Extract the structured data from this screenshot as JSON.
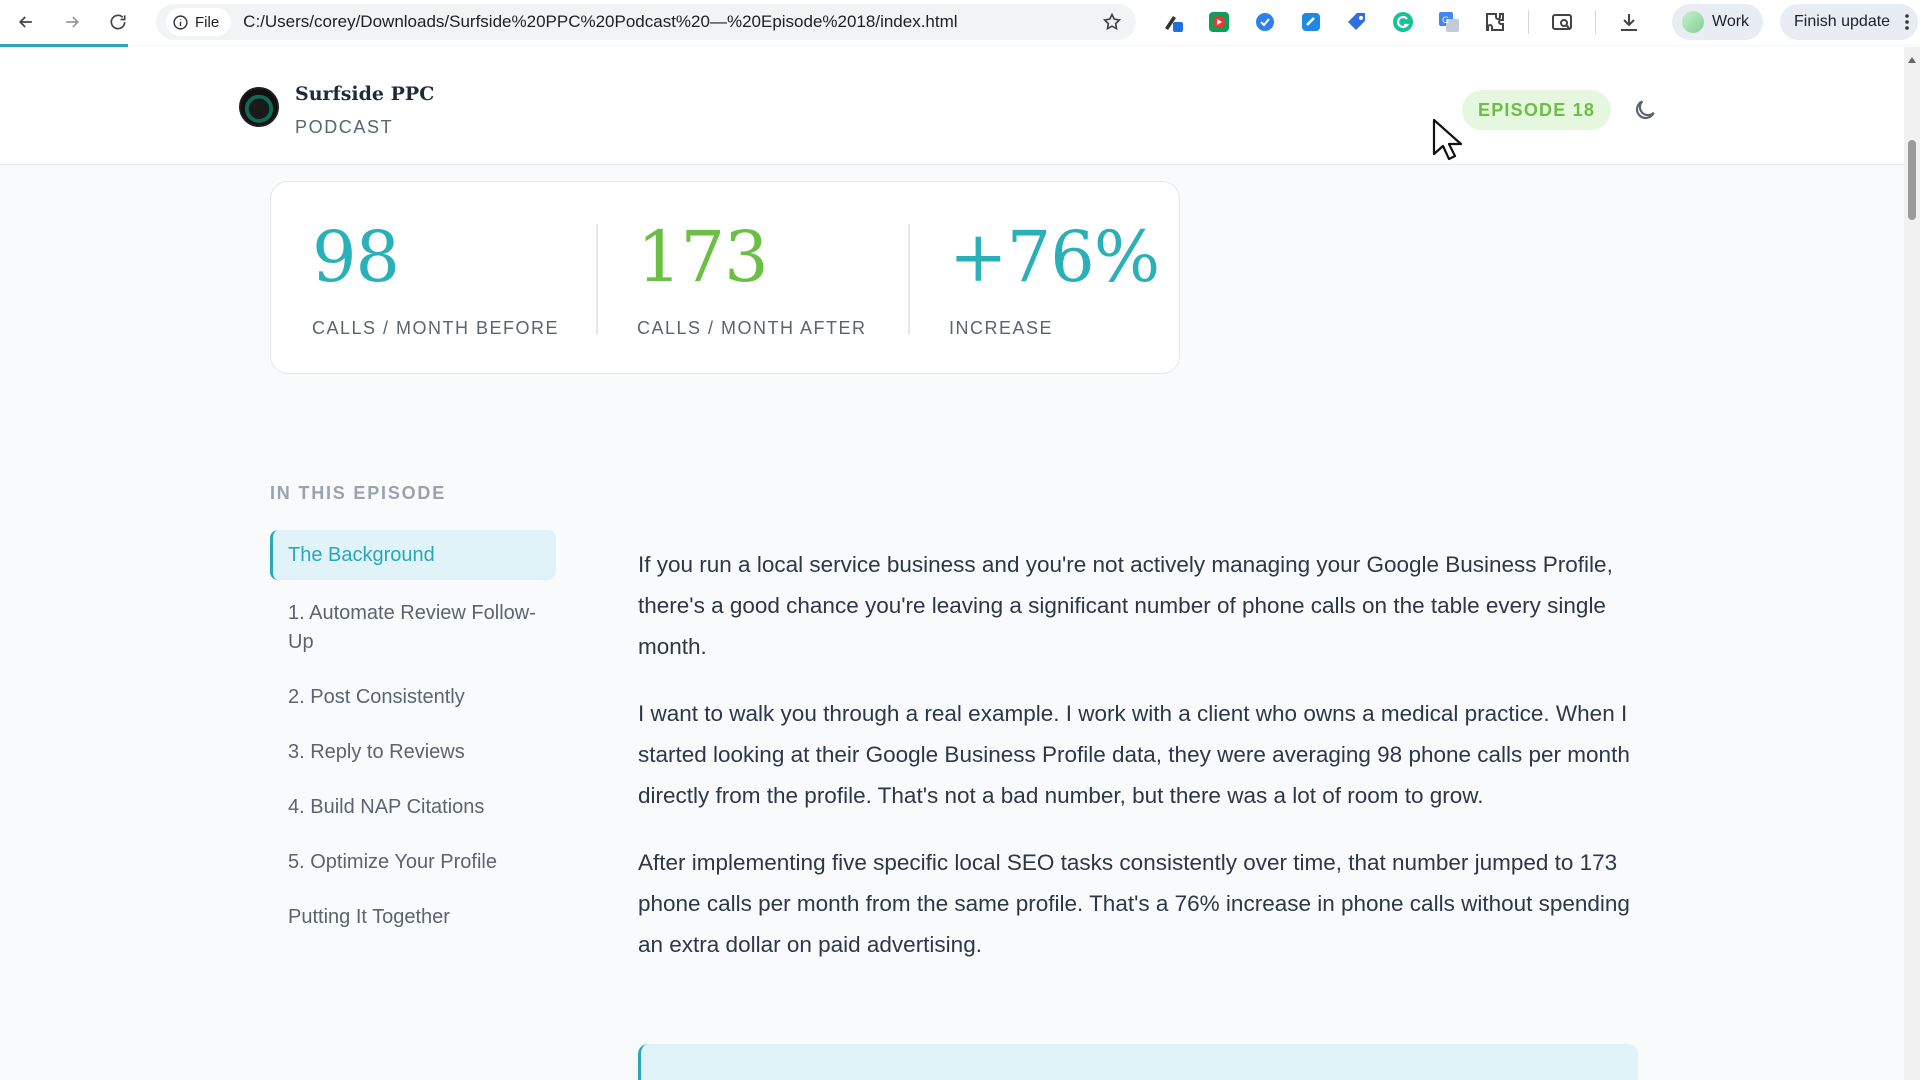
{
  "browser": {
    "file_label": "File",
    "url": "C:/Users/corey/Downloads/Surfside%20PPC%20Podcast%20—%20Episode%2018/index.html",
    "profile_label": "Work",
    "update_label": "Finish update"
  },
  "header": {
    "brand_name": "Surfside PPC",
    "brand_sub": "PODCAST",
    "episode_badge": "EPISODE 18"
  },
  "stats": [
    {
      "value": "98",
      "label": "CALLS / MONTH BEFORE"
    },
    {
      "value": "173",
      "label": "CALLS / MONTH AFTER"
    },
    {
      "value": "+76%",
      "label": "INCREASE"
    }
  ],
  "toc": {
    "title": "IN THIS EPISODE",
    "items": [
      {
        "label": "The Background"
      },
      {
        "label": "1. Automate Review Follow-Up"
      },
      {
        "label": "2. Post Consistently"
      },
      {
        "label": "3. Reply to Reviews"
      },
      {
        "label": "4. Build NAP Citations"
      },
      {
        "label": "5. Optimize Your Profile"
      },
      {
        "label": "Putting It Together"
      }
    ]
  },
  "article": {
    "paragraphs": [
      "If you run a local service business and you're not actively managing your Google Business Profile, there's a good chance you're leaving a significant number of phone calls on the table every single month.",
      "I want to walk you through a real example. I work with a client who owns a medical practice. When I started looking at their Google Business Profile data, they were averaging 98 phone calls per month directly from the profile. That's not a bad number, but there was a lot of room to grow.",
      "After implementing five specific local SEO tasks consistently over time, that number jumped to 173 phone calls per month from the same profile. That's a 76% increase in phone calls without spending an extra dollar on paid advertising."
    ]
  },
  "colors": {
    "teal": "#2ab0b8",
    "green": "#6cbf45",
    "toc_active_bg": "#dff3f8"
  },
  "icons": [
    "back-arrow-icon",
    "forward-arrow-icon",
    "reload-icon",
    "info-icon",
    "star-icon",
    "extensions-icon",
    "download-icon",
    "moon-icon",
    "cursor-icon"
  ]
}
